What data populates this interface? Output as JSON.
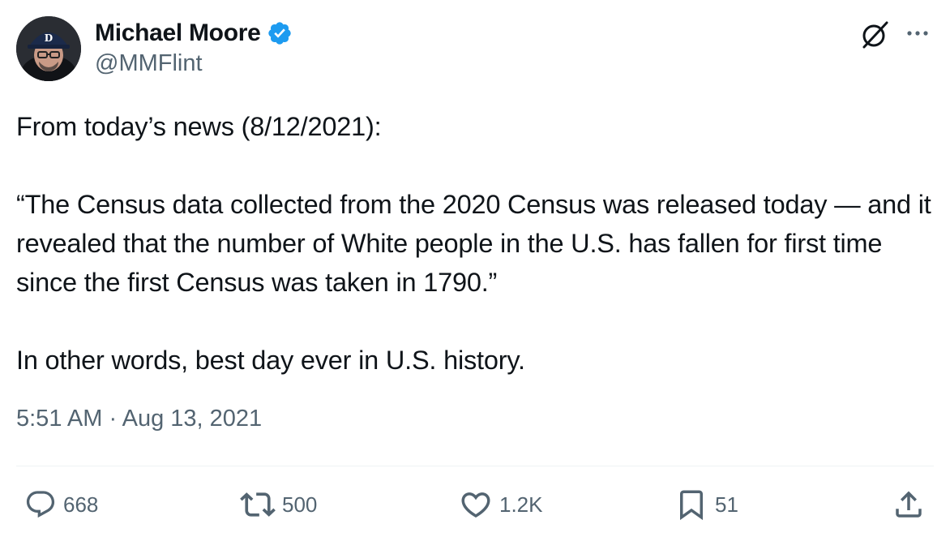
{
  "author": {
    "display_name": "Michael Moore",
    "handle": "@MMFlint",
    "verified": true,
    "avatar_icon": "avatar-photo",
    "verified_color": "#1d9bf0"
  },
  "header_actions": {
    "grok_icon": "grok-icon",
    "more_icon": "more-horizontal-icon"
  },
  "tweet": {
    "paragraphs": [
      "From today’s news (8/12/2021):",
      "“The Census data collected from the 2020 Census was released today — and it revealed that the number of White people in the U.S. has fallen for first time since the first Census was taken in 1790.”",
      "In other words, best day ever in U.S. history."
    ],
    "time": "5:51 AM",
    "separator": "·",
    "date": "Aug 13, 2021"
  },
  "actions": {
    "replies": {
      "icon": "reply-icon",
      "count": "668"
    },
    "reposts": {
      "icon": "repost-icon",
      "count": "500"
    },
    "likes": {
      "icon": "heart-icon",
      "count": "1.2K"
    },
    "bookmarks": {
      "icon": "bookmark-icon",
      "count": "51"
    },
    "share": {
      "icon": "share-icon"
    }
  },
  "colors": {
    "text_primary": "#0f1419",
    "text_secondary": "#536471",
    "divider": "#eff3f4"
  }
}
